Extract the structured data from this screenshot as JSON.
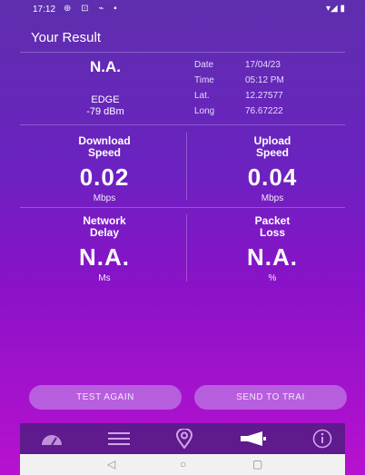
{
  "status_bar": {
    "time": "17:12",
    "icons": "⊕ ⊡ ⌁ ▪",
    "right": "▾◢ ▮"
  },
  "header": {
    "title": "Your Result"
  },
  "network": {
    "value": "N.A.",
    "type": "EDGE",
    "signal": "-79 dBm"
  },
  "info": {
    "date_label": "Date",
    "date_value": "17/04/23",
    "time_label": "Time",
    "time_value": "05:12 PM",
    "lat_label": "Lat.",
    "lat_value": "12.27577",
    "long_label": "Long",
    "long_value": "76.67222"
  },
  "download": {
    "label_line1": "Download",
    "label_line2": "Speed",
    "value": "0.02",
    "unit": "Mbps"
  },
  "upload": {
    "label_line1": "Upload",
    "label_line2": "Speed",
    "value": "0.04",
    "unit": "Mbps"
  },
  "delay": {
    "label_line1": "Network",
    "label_line2": "Delay",
    "value": "N.A.",
    "unit": "Ms"
  },
  "loss": {
    "label_line1": "Packet",
    "label_line2": "Loss",
    "value": "N.A.",
    "unit": "%"
  },
  "buttons": {
    "test_again": "TEST AGAIN",
    "send": "SEND TO TRAI"
  },
  "bottom_nav": {
    "items": [
      {
        "icon": "speedometer-icon"
      },
      {
        "icon": "list-icon"
      },
      {
        "icon": "location-pin-icon"
      },
      {
        "icon": "megaphone-icon",
        "active": true
      },
      {
        "icon": "info-icon"
      }
    ]
  },
  "system_nav": {
    "back": "◁",
    "home": "○",
    "recents": "▢"
  }
}
